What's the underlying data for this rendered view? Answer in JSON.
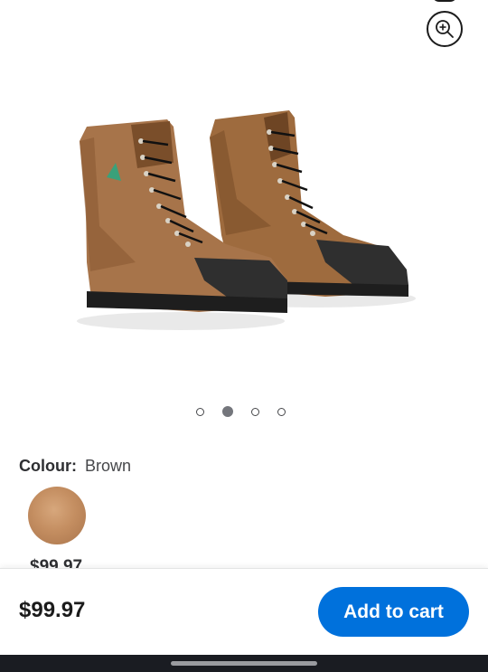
{
  "product": {
    "image_alt": "Brown leather steel-toe work boots",
    "carousel": {
      "total": 4,
      "active_index": 1
    }
  },
  "colour": {
    "label": "Colour:",
    "value": "Brown",
    "swatch_color": "#c48e61"
  },
  "variant_price": "$99.97",
  "bottom_bar": {
    "price": "$99.97",
    "add_to_cart_label": "Add to cart",
    "button_color": "#0071dc"
  },
  "icons": {
    "zoom": "zoom-in-icon"
  }
}
